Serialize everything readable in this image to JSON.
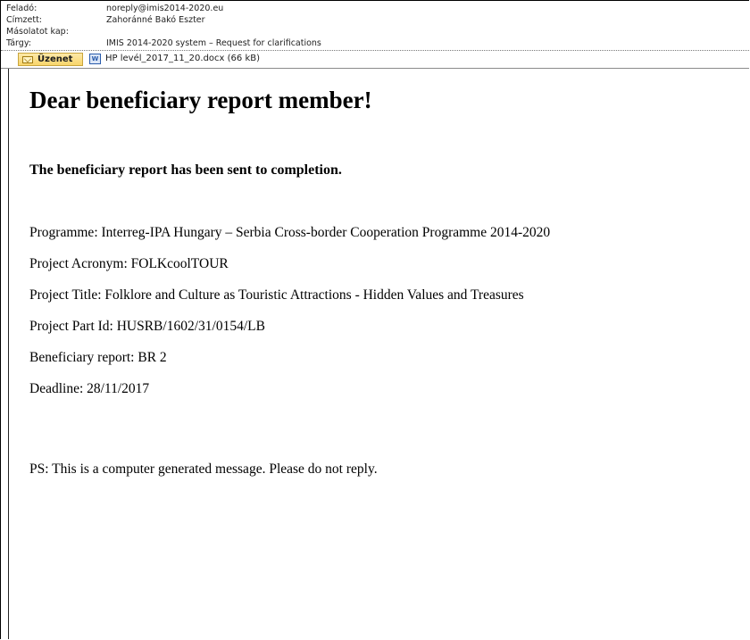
{
  "header": {
    "from_label": "Feladó:",
    "from_value": "noreply@imis2014-2020.eu",
    "to_label": "Címzett:",
    "to_value": "Zahoránné Bakó Eszter",
    "cc_label": "Másolatot kap:",
    "cc_value": "",
    "subject_label": "Tárgy:",
    "subject_value": "IMIS 2014-2020 system – Request for clarifications"
  },
  "tabs": {
    "message_label": "Üzenet",
    "message_icon": "envelope-icon",
    "attachment_label": "HP levél_2017_11_20.docx (66 kB)",
    "attachment_icon": "word-document-icon"
  },
  "message": {
    "greeting": "Dear beneficiary report member!",
    "subheading": "The beneficiary report has been sent to completion.",
    "programme": "Programme: Interreg-IPA Hungary – Serbia Cross-border Cooperation Programme 2014-2020",
    "acronym": "Project Acronym: FOLKcoolTOUR",
    "title": "Project Title: Folklore and Culture as Touristic Attractions - Hidden Values and Treasures",
    "part_id": "Project Part Id: HUSRB/1602/31/0154/LB",
    "report": "Beneficiary report: BR 2",
    "deadline": "Deadline: 28/11/2017",
    "ps": "PS: This is a computer generated message. Please do not reply."
  }
}
